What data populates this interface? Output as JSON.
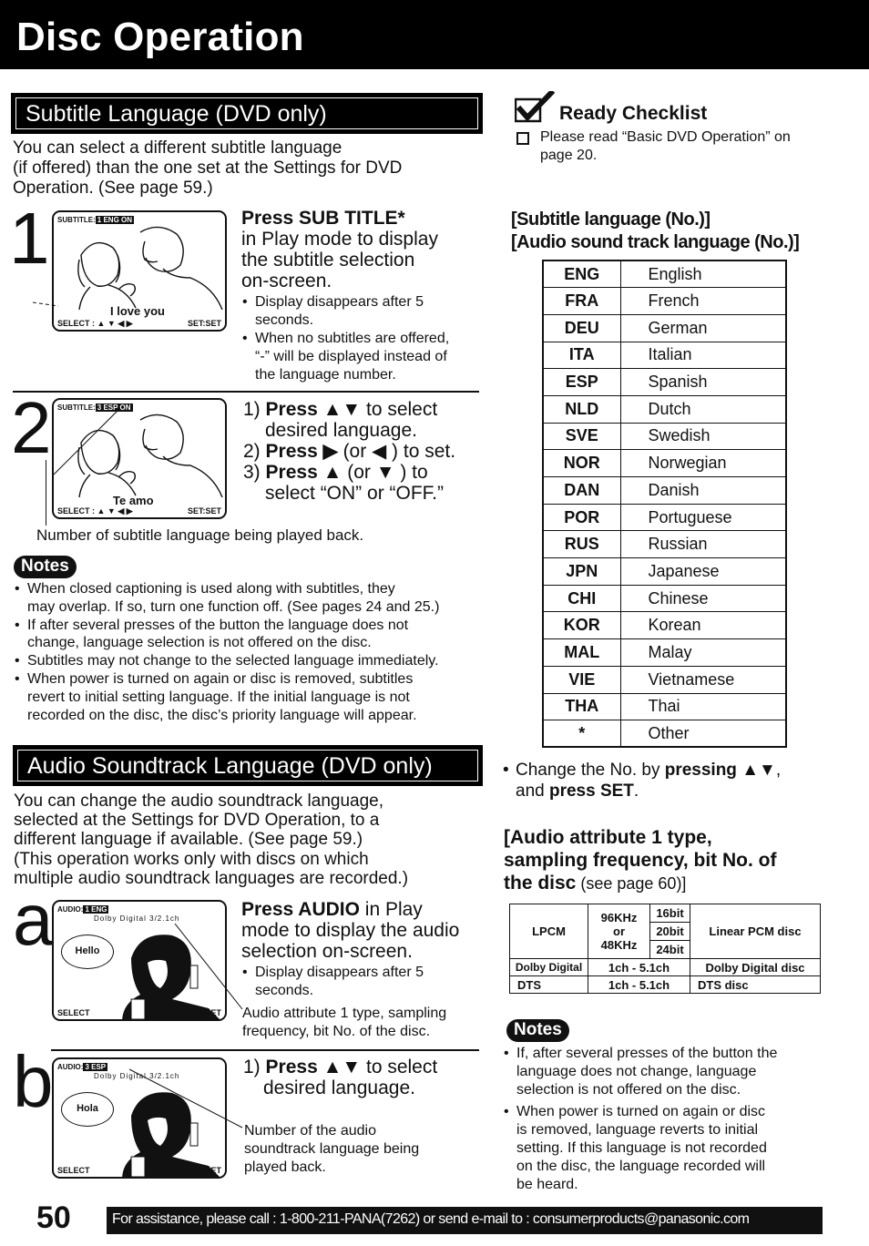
{
  "header": {
    "title": "Disc Operation"
  },
  "subtitle_section": {
    "title": "Subtitle Language (DVD only)",
    "intro": [
      "You can select a different subtitle language",
      "(if offered) than the one set at the Settings for DVD",
      "Operation. (See page 59.)"
    ],
    "step1": {
      "number": "1",
      "screen": {
        "osd_label": "SUBTITLE:",
        "osd_value": "1 ENG ON",
        "caption": "I love you",
        "select_label": "SELECT : ▲ ▼ ◀ ▶",
        "set_label": "SET:SET"
      },
      "title_bold": "Press SUB TITLE*",
      "title_lines": [
        "in Play mode to display",
        "the subtitle selection",
        "on-screen."
      ],
      "bullets": [
        [
          "Display disappears after 5",
          "seconds."
        ],
        [
          "When no subtitles are offered,",
          "“-” will be displayed instead of",
          "the language number."
        ]
      ]
    },
    "step2": {
      "number": "2",
      "screen": {
        "osd_label": "SUBTITLE:",
        "osd_value": "3 ESP ON",
        "caption": "Te amo",
        "select_label": "SELECT : ▲ ▼ ◀ ▶",
        "set_label": "SET:SET"
      },
      "items": [
        {
          "num": "1)",
          "bold": "Press ▲▼",
          "rest": " to select",
          "cont": "desired language."
        },
        {
          "num": "2)",
          "bold": "Press ▶",
          "rest": " (or ◀ ) to set.",
          "cont": ""
        },
        {
          "num": "3)",
          "bold": "Press ▲",
          "rest": " (or ▼ ) to",
          "cont": "select “ON” or “OFF.”"
        }
      ],
      "callout": "Number of subtitle language being played back."
    },
    "notes": {
      "badge": "Notes",
      "items": [
        [
          "When closed captioning is used along with subtitles, they",
          "may overlap. If so, turn one function off. (See pages 24 and 25.)"
        ],
        [
          "If after several presses of the button the language does not",
          "change, language selection is not offered on the disc."
        ],
        [
          "Subtitles may not change to the selected language immediately."
        ],
        [
          "When power is turned on again or disc is removed, subtitles",
          "revert to initial setting language. If the initial language is not",
          "recorded on the disc, the disc’s priority language will appear."
        ]
      ]
    }
  },
  "audio_section": {
    "title": "Audio Soundtrack Language (DVD only)",
    "intro": [
      "You can change the audio soundtrack language,",
      "selected at the Settings for DVD Operation, to a",
      "different language if available. (See page 59.)",
      "(This operation works only with discs on which",
      "multiple audio soundtrack languages are recorded.)"
    ],
    "step_a": {
      "letter": "a",
      "screen": {
        "osd_label": "AUDIO:",
        "osd_value": "1 ENG",
        "osd_line2": "Dolby Digital 3/2.1ch",
        "bubble": "Hello",
        "select_label": "SELECT",
        "set_label": "T:SET"
      },
      "title_bold": "Press AUDIO",
      "title_rest": " in Play",
      "title_lines": [
        "mode to display the audio",
        "selection on-screen."
      ],
      "bullets": [
        [
          "Display disappears after 5",
          "seconds."
        ]
      ],
      "callout": [
        "Audio attribute 1 type, sampling",
        "frequency, bit No. of the disc."
      ]
    },
    "step_b": {
      "letter": "b",
      "screen": {
        "osd_label": "AUDIO:",
        "osd_value": "3 ESP",
        "osd_line2": "Dolby Digital 3/2.1ch",
        "bubble": "Hola",
        "select_label": "SELECT",
        "set_label": "T:SET"
      },
      "item": {
        "num": "1)",
        "bold": "Press ▲▼",
        "rest": " to select",
        "cont": "desired language."
      },
      "callout": [
        "Number of the audio",
        "soundtrack language being",
        "played back."
      ]
    }
  },
  "checklist": {
    "title": "Ready Checklist",
    "item_lines": [
      "Please read “Basic DVD Operation” on",
      "page 20."
    ]
  },
  "language_table": {
    "heading": [
      "[Subtitle language (No.)]",
      "[Audio sound track language (No.)]"
    ],
    "rows": [
      {
        "code": "ENG",
        "name": "English"
      },
      {
        "code": "FRA",
        "name": "French"
      },
      {
        "code": "DEU",
        "name": "German"
      },
      {
        "code": "ITA",
        "name": "Italian"
      },
      {
        "code": "ESP",
        "name": "Spanish"
      },
      {
        "code": "NLD",
        "name": "Dutch"
      },
      {
        "code": "SVE",
        "name": "Swedish"
      },
      {
        "code": "NOR",
        "name": "Norwegian"
      },
      {
        "code": "DAN",
        "name": "Danish"
      },
      {
        "code": "POR",
        "name": "Portuguese"
      },
      {
        "code": "RUS",
        "name": "Russian"
      },
      {
        "code": "JPN",
        "name": "Japanese"
      },
      {
        "code": "CHI",
        "name": "Chinese"
      },
      {
        "code": "KOR",
        "name": "Korean"
      },
      {
        "code": "MAL",
        "name": "Malay"
      },
      {
        "code": "VIE",
        "name": "Vietnamese"
      },
      {
        "code": "THA",
        "name": "Thai"
      },
      {
        "code": "*",
        "name": "Other"
      }
    ],
    "change_note": {
      "pre": "Change the No. by ",
      "bold1": "pressing ▲▼",
      "mid": ",",
      "line2_pre": "and ",
      "bold2": "press SET",
      "line2_post": "."
    }
  },
  "audio_attr": {
    "heading_bold": [
      "[Audio attribute 1 type,",
      "sampling frequency, bit No. of",
      "the disc"
    ],
    "heading_rest": " (see page 60)]",
    "lpcm": {
      "type": "LPCM",
      "freq": [
        "96KHz",
        "or",
        "48KHz"
      ],
      "bits": [
        "16bit",
        "20bit",
        "24bit"
      ],
      "desc": "Linear PCM disc"
    },
    "dolby": {
      "type": "Dolby Digital",
      "ch": "1ch - 5.1ch",
      "desc": "Dolby Digital disc"
    },
    "dts": {
      "type": "DTS",
      "ch": "1ch - 5.1ch",
      "desc": "DTS disc"
    }
  },
  "right_notes": {
    "badge": "Notes",
    "items": [
      [
        "If, after several presses of the button the",
        "language does not change, language",
        "selection is not offered on the disc."
      ],
      [
        "When power is turned on again or disc",
        "is removed, language reverts to initial",
        "setting. If this language is not recorded",
        "on the disc, the language recorded will",
        "be heard."
      ]
    ]
  },
  "footer": {
    "page_number": "50",
    "assistance": "For assistance, please call : 1-800-211-PANA(7262) or send e-mail to : consumerproducts@panasonic.com"
  }
}
